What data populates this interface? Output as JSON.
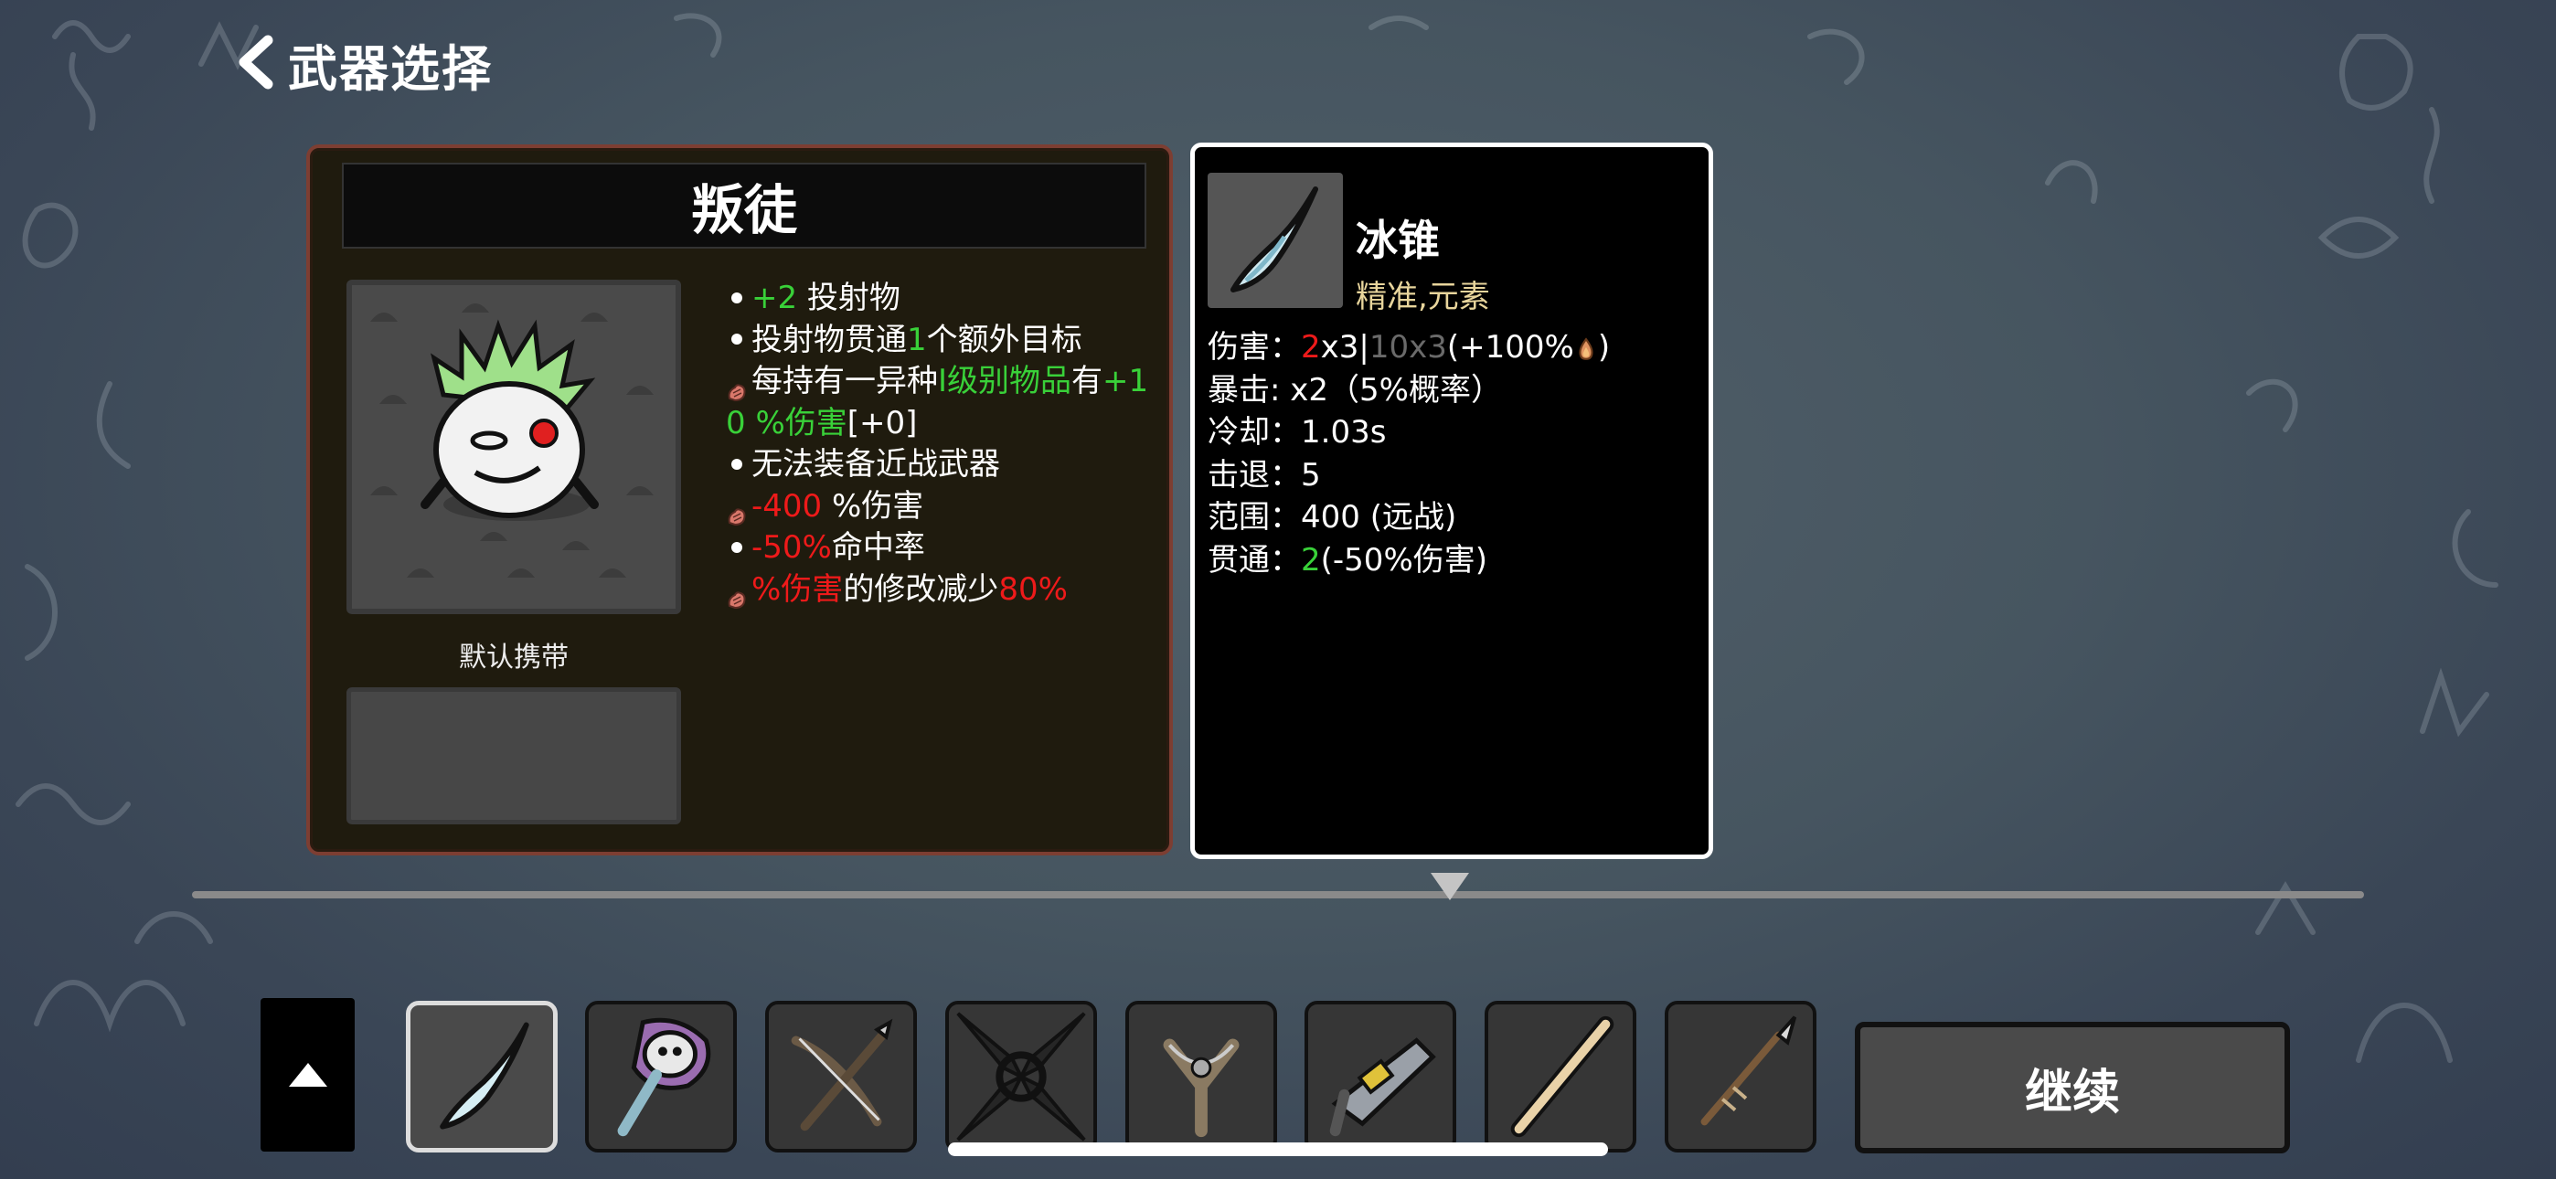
{
  "header": {
    "back_icon": "chevron-left-icon",
    "title": "武器选择"
  },
  "character": {
    "name": "叛徒",
    "default_carry_label": "默认携带",
    "stats": [
      {
        "icon": "bullet",
        "parts": [
          {
            "t": "+2",
            "c": "green"
          },
          {
            "t": " 投射物",
            "c": "white"
          }
        ]
      },
      {
        "icon": "bullet",
        "parts": [
          {
            "t": "投射物贯通",
            "c": "white"
          },
          {
            "t": "1",
            "c": "green"
          },
          {
            "t": "个额外目标",
            "c": "white"
          }
        ]
      },
      {
        "icon": "bag",
        "parts": [
          {
            "t": "每持有一异种",
            "c": "white"
          },
          {
            "t": "I级别物品",
            "c": "green"
          },
          {
            "t": "有",
            "c": "white"
          },
          {
            "t": "+1",
            "c": "green"
          }
        ]
      },
      {
        "icon": "none",
        "parts": [
          {
            "t": "0 %伤害",
            "c": "green"
          },
          {
            "t": "[+0]",
            "c": "white"
          }
        ]
      },
      {
        "icon": "bullet",
        "parts": [
          {
            "t": "无法装备近战武器",
            "c": "white"
          }
        ]
      },
      {
        "icon": "bag",
        "parts": [
          {
            "t": "-400",
            "c": "red"
          },
          {
            "t": " %伤害",
            "c": "white"
          }
        ]
      },
      {
        "icon": "bullet",
        "parts": [
          {
            "t": "-50%",
            "c": "red"
          },
          {
            "t": "命中率",
            "c": "white"
          }
        ]
      },
      {
        "icon": "bag",
        "parts": [
          {
            "t": "%伤害",
            "c": "red"
          },
          {
            "t": "的修改减少",
            "c": "white"
          },
          {
            "t": "80%",
            "c": "red"
          }
        ]
      }
    ]
  },
  "weapon": {
    "name": "冰锥",
    "tags": "精准,元素",
    "stats": [
      {
        "parts": [
          {
            "t": "伤害：",
            "c": "white"
          },
          {
            "t": "2",
            "c": "red"
          },
          {
            "t": "x3|",
            "c": "white"
          },
          {
            "t": "10x3",
            "c": "grey"
          },
          {
            "t": "(+100%",
            "c": "white"
          },
          {
            "t": "ICON",
            "c": "fire"
          },
          {
            "t": ")",
            "c": "white"
          }
        ]
      },
      {
        "parts": [
          {
            "t": "暴击:  x2（5%概率）",
            "c": "white"
          }
        ]
      },
      {
        "parts": [
          {
            "t": "冷却：1.03s",
            "c": "white"
          }
        ]
      },
      {
        "parts": [
          {
            "t": "击退：5",
            "c": "white"
          }
        ]
      },
      {
        "parts": [
          {
            "t": "范围：400 (远战)",
            "c": "white"
          }
        ]
      },
      {
        "parts": [
          {
            "t": "贯通：",
            "c": "white"
          },
          {
            "t": "2",
            "c": "green"
          },
          {
            "t": "(-50%伤害)",
            "c": "white"
          }
        ]
      }
    ]
  },
  "weapons_bar": [
    {
      "name": "ice-spike-icon",
      "selected": true
    },
    {
      "name": "skull-staff-icon",
      "selected": false
    },
    {
      "name": "crossbow-icon",
      "selected": false
    },
    {
      "name": "shuriken-icon",
      "selected": false
    },
    {
      "name": "slingshot-icon",
      "selected": false
    },
    {
      "name": "laser-gun-icon",
      "selected": false
    },
    {
      "name": "wooden-stick-icon",
      "selected": false
    },
    {
      "name": "spear-icon",
      "selected": false
    }
  ],
  "continue_label": "继续",
  "colors": {
    "green": "#39d139",
    "red": "#ee1a1a",
    "grey": "#6a6a6a",
    "tag": "#e8d59c",
    "panel_border": "#7d3e32"
  }
}
